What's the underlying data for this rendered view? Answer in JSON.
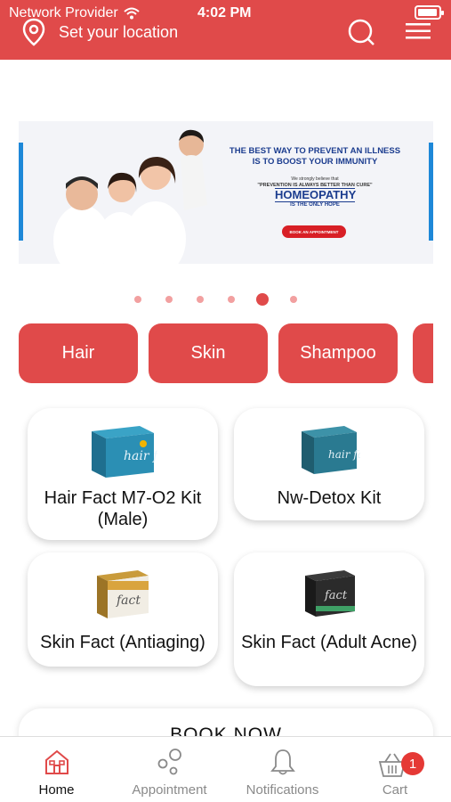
{
  "status_bar": {
    "carrier": "Network Provider",
    "time": "4:02 PM",
    "battery_level": 0.95
  },
  "header": {
    "location_label": "Set your location",
    "location_icon": "location-pin-icon",
    "search_icon": "search-icon",
    "menu_icon": "menu-icon",
    "color": "#e04a4a"
  },
  "banner": {
    "headline_1": "THE BEST WAY TO PREVENT AN ILLNESS",
    "headline_2": "IS TO BOOST YOUR IMMUNITY",
    "small_text": "We strongly believe that",
    "prevention": "\"PREVENTION IS ALWAYS BETTER THAN CURE\"",
    "title": "HOMEOPATHY",
    "subtitle": "IS THE ONLY HOPE",
    "cta": "BOOK AN APPOINTMENT"
  },
  "carousel": {
    "total": 6,
    "active_index": 4
  },
  "categories": [
    {
      "label": "Hair"
    },
    {
      "label": "Skin"
    },
    {
      "label": "Shampoo"
    },
    {
      "label": ""
    }
  ],
  "products": [
    {
      "name": "Hair Fact M7-O2 Kit (Male)",
      "box": "hair fact"
    },
    {
      "name": "Nw-Detox Kit",
      "box": "hair fact"
    },
    {
      "name": "Skin Fact (Antiaging)",
      "box": "fact"
    },
    {
      "name": "Skin Fact (Adult Acne)",
      "box": "fact"
    }
  ],
  "book_now": {
    "label": "BOOK NOW"
  },
  "tabs": [
    {
      "label": "Home",
      "icon": "home-icon",
      "active": true
    },
    {
      "label": "Appointment",
      "icon": "appointment-icon",
      "active": false
    },
    {
      "label": "Notifications",
      "icon": "bell-icon",
      "active": false
    },
    {
      "label": "Cart",
      "icon": "cart-icon",
      "active": false,
      "badge": "1"
    }
  ]
}
